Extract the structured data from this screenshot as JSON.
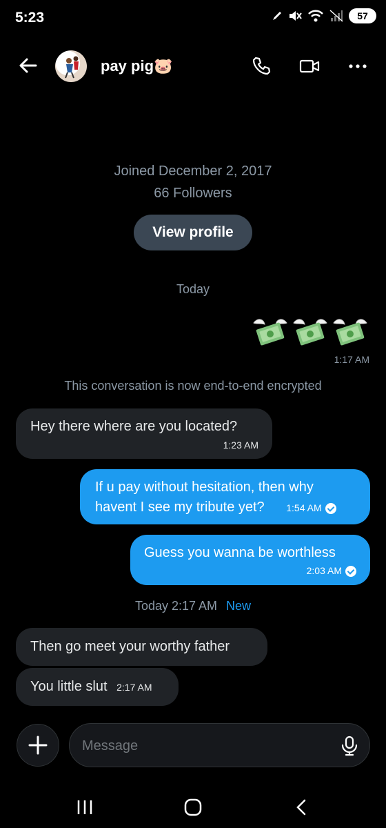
{
  "status_bar": {
    "time": "5:23",
    "battery": "57"
  },
  "header": {
    "title": "pay pig🐷"
  },
  "profile": {
    "joined": "Joined December 2, 2017",
    "followers": "66 Followers",
    "view_profile": "View profile"
  },
  "day_label": "Today",
  "emoji_message": {
    "emojis": [
      "💸",
      "💸",
      "💸"
    ],
    "time": "1:17 AM"
  },
  "encryption_notice": "This conversation is now end-to-end encrypted",
  "messages": [
    {
      "direction": "in",
      "text": "Hey there where are you located?",
      "time": "1:23 AM"
    },
    {
      "direction": "out",
      "text_line1": "If u pay without hesitation,  then why",
      "text_line2": "havent I see my tribute yet?",
      "time": "1:54 AM"
    },
    {
      "direction": "out",
      "text": "Guess you wanna be worthless",
      "time": "2:03 AM"
    }
  ],
  "new_divider": {
    "label": "Today 2:17 AM",
    "badge": "New"
  },
  "new_messages": [
    {
      "direction": "in",
      "text": "Then go meet your worthy father"
    },
    {
      "direction": "in",
      "text": "You little slut",
      "time": "2:17 AM"
    }
  ],
  "composer": {
    "placeholder": "Message"
  },
  "colors": {
    "accent": "#1d9bf0",
    "incoming_bubble": "#202327",
    "background": "#000000"
  }
}
